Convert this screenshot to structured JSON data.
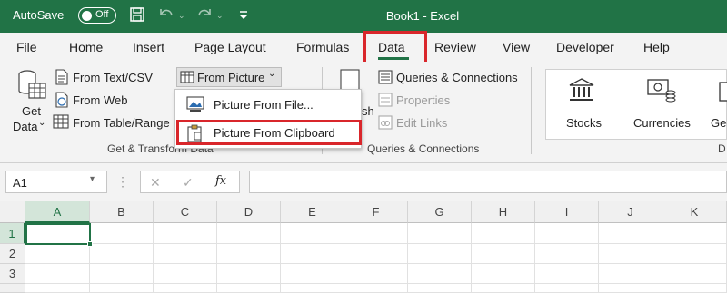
{
  "titlebar": {
    "autosave_label": "AutoSave",
    "autosave_state": "Off",
    "doc_title": "Book1  -  Excel"
  },
  "tabs": [
    "File",
    "Home",
    "Insert",
    "Page Layout",
    "Formulas",
    "Data",
    "Review",
    "View",
    "Developer",
    "Help"
  ],
  "active_tab": "Data",
  "ribbon": {
    "get_data_line1": "Get",
    "get_data_line2": "Data",
    "from_text_csv": "From Text/CSV",
    "from_web": "From Web",
    "from_table_range": "From Table/Range",
    "from_picture": "From Picture",
    "group_get_transform": "Get & Transform Data",
    "refresh_partial": "sh",
    "queries_connections": "Queries & Connections",
    "properties": "Properties",
    "edit_links": "Edit Links",
    "group_queries": "Queries & Connections",
    "stocks": "Stocks",
    "currencies": "Currencies",
    "geo_partial": "Geo",
    "group_data_types_partial": "D"
  },
  "dropdown": {
    "item1": "Picture From File...",
    "item2": "Picture From Clipboard"
  },
  "formula_bar": {
    "name_box": "A1",
    "cancel": "✕",
    "enter": "✓",
    "fx": "fx",
    "value": ""
  },
  "grid": {
    "columns": [
      "A",
      "B",
      "C",
      "D",
      "E",
      "F",
      "G",
      "H",
      "I",
      "J",
      "K"
    ],
    "rows": [
      "1",
      "2",
      "3"
    ]
  },
  "colors": {
    "brand_green": "#217346",
    "highlight_red": "#d9262b"
  }
}
